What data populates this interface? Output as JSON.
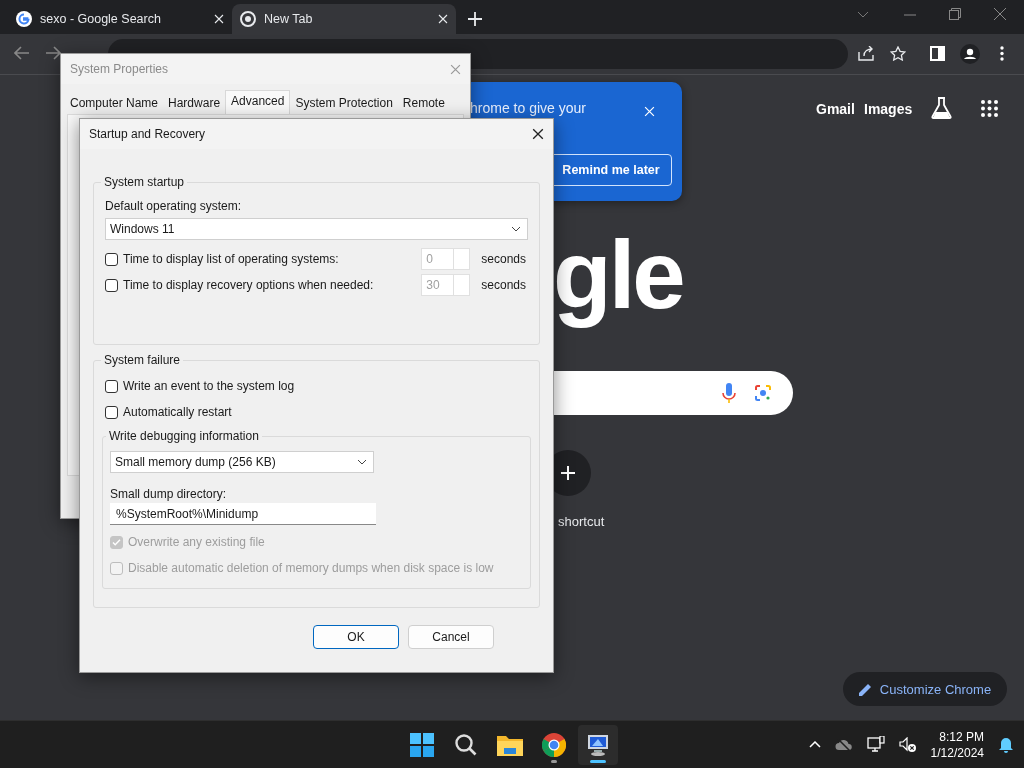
{
  "browser": {
    "tabs": [
      {
        "title": "sexo - Google Search",
        "selected": false
      },
      {
        "title": "New Tab",
        "selected": true
      }
    ]
  },
  "page": {
    "promo": {
      "text": "hrome to give your",
      "button": "Remind me later"
    },
    "header_links": [
      "Gmail",
      "Images"
    ],
    "logo_text": "gle",
    "shortcut_label": "shortcut",
    "customize_button": "Customize Chrome"
  },
  "system_properties": {
    "title": "System Properties",
    "tabs": [
      {
        "label": "Computer Name",
        "selected": false
      },
      {
        "label": "Hardware",
        "selected": false
      },
      {
        "label": "Advanced",
        "selected": true
      },
      {
        "label": "System Protection",
        "selected": false
      },
      {
        "label": "Remote",
        "selected": false
      }
    ]
  },
  "startup_dialog": {
    "title": "Startup and Recovery",
    "system_startup": {
      "legend": "System startup",
      "default_os_label": "Default operating system:",
      "default_os": "Windows 11",
      "timers": [
        {
          "label": "Time to display list of operating systems:",
          "checked": false,
          "value": "0",
          "unit": "seconds"
        },
        {
          "label": "Time to display recovery options when needed:",
          "checked": false,
          "value": "30",
          "unit": "seconds"
        }
      ]
    },
    "system_failure": {
      "legend": "System failure",
      "options": [
        {
          "label": "Write an event to the system log",
          "checked": false,
          "disabled": false
        },
        {
          "label": "Automatically restart",
          "checked": false,
          "disabled": false
        }
      ],
      "debugging": {
        "legend": "Write debugging information",
        "dump_type": "Small memory dump (256 KB)",
        "directory_label": "Small dump directory:",
        "directory": "%SystemRoot%\\Minidump",
        "options": [
          {
            "label": "Overwrite any existing file",
            "checked": true,
            "disabled": true
          },
          {
            "label": "Disable automatic deletion of memory dumps when disk space is low",
            "checked": false,
            "disabled": true
          }
        ]
      }
    },
    "buttons": [
      {
        "label": "OK",
        "default": true
      },
      {
        "label": "Cancel",
        "default": false
      }
    ]
  },
  "taskbar": {
    "apps": [
      {
        "kind": "start",
        "running": false,
        "selected": false
      },
      {
        "kind": "search",
        "running": false,
        "selected": false
      },
      {
        "kind": "files",
        "running": false,
        "selected": false
      },
      {
        "kind": "chrome",
        "running": true,
        "selected": false
      },
      {
        "kind": "system",
        "running": true,
        "selected": true
      }
    ],
    "time": "8:12 PM",
    "date": "1/12/2024"
  }
}
